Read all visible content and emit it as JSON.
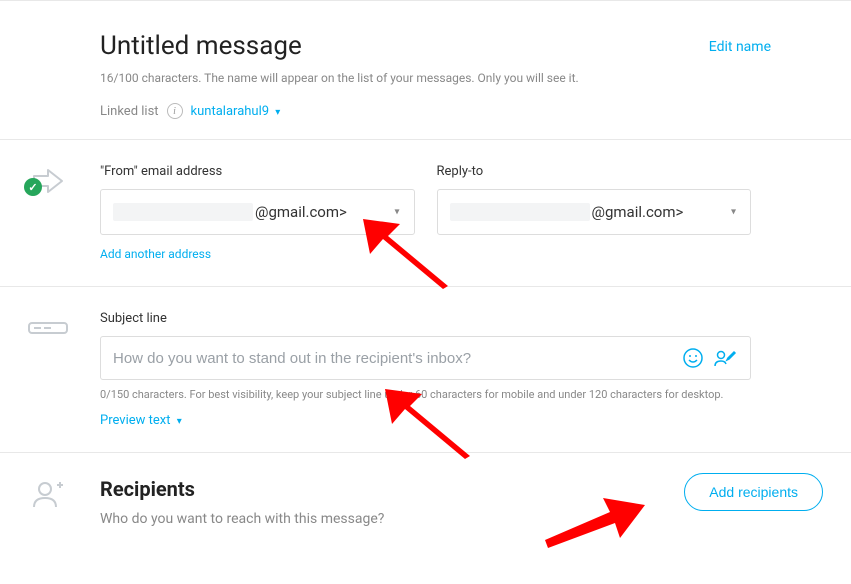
{
  "header": {
    "title": "Untitled message",
    "edit_name": "Edit name",
    "char_info": "16/100 characters. The name will appear on the list of your messages. Only you will see it.",
    "linked_list_label": "Linked list",
    "linked_list_value": "kuntalarahul9"
  },
  "from_section": {
    "from_label": "\"From\" email address",
    "from_value": "@gmail.com>",
    "reply_to_label": "Reply-to",
    "reply_to_value": "@gmail.com>",
    "add_another": "Add another address"
  },
  "subject_section": {
    "label": "Subject line",
    "placeholder": "How do you want to stand out in the recipient's inbox?",
    "helper": "0/150 characters. For best visibility, keep your subject line under 60 characters for mobile and under 120 characters for desktop.",
    "preview_text": "Preview text"
  },
  "recipients_section": {
    "title": "Recipients",
    "subtitle": "Who do you want to reach with this message?",
    "button": "Add recipients"
  }
}
